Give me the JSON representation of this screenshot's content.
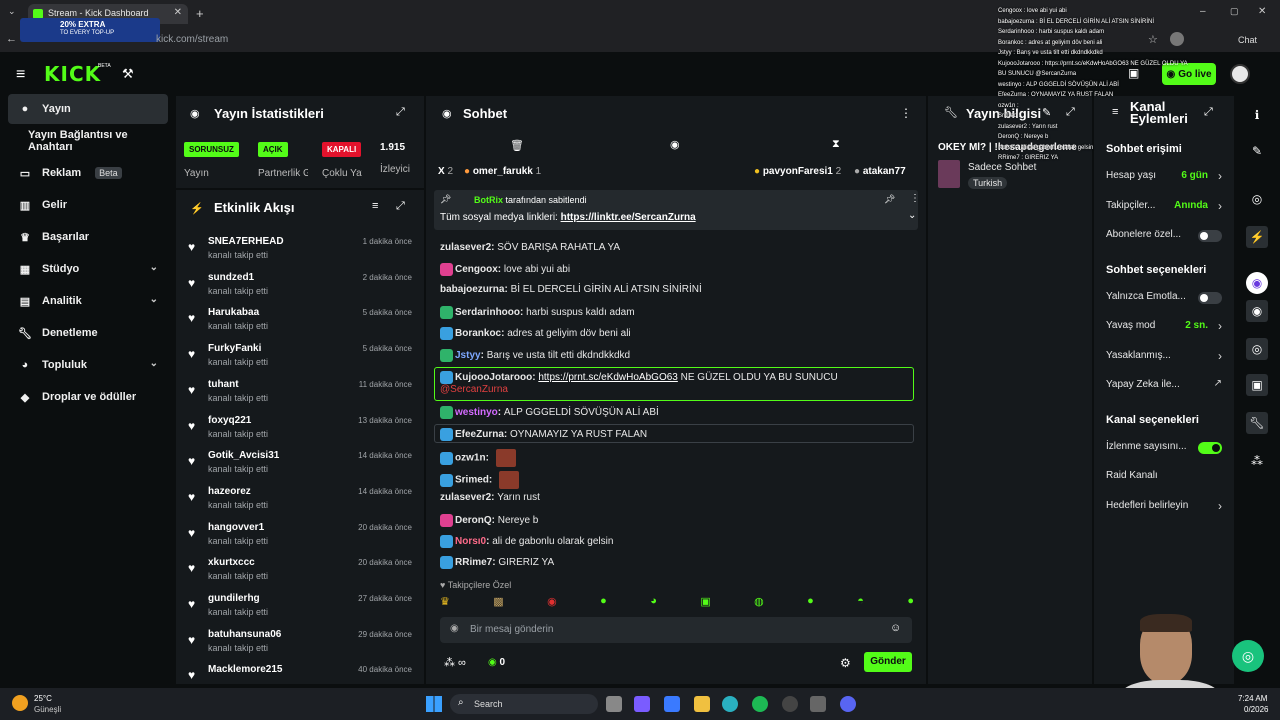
{
  "browser": {
    "tab_title": "Stream - Kick Dashboard",
    "url_visible": "kick.com/stream",
    "chat_button": "Chat",
    "promo_text": "20% EXTRA",
    "promo_sub": "TO EVERY TOP-UP"
  },
  "header": {
    "logo": "KICK",
    "logo_badge": "BETA",
    "go_live": "Go live"
  },
  "sidebar": {
    "items": [
      {
        "label": "Yayın",
        "icon": "broadcast-icon"
      },
      {
        "label": "Yayın Bağlantısı ve Anahtarı",
        "icon": ""
      },
      {
        "label": "Reklam",
        "icon": "tv-icon",
        "badge": "Beta"
      },
      {
        "label": "Gelir",
        "icon": "chart-icon"
      },
      {
        "label": "Başarılar",
        "icon": "trophy-icon"
      },
      {
        "label": "Stüdyo",
        "icon": "studio-icon"
      },
      {
        "label": "Analitik",
        "icon": "analytics-icon"
      },
      {
        "label": "Denetleme",
        "icon": "wrench-icon"
      },
      {
        "label": "Topluluk",
        "icon": "community-icon"
      },
      {
        "label": "Droplar ve ödüller",
        "icon": "gift-icon"
      }
    ]
  },
  "stats": {
    "title": "Yayın İstatistikleri",
    "cols": [
      {
        "badge": "SORUNSUZ",
        "label": "Yayın",
        "color": "#53fc18"
      },
      {
        "badge": "AÇIK",
        "label": "Partnerlik Gelir",
        "color": "#53fc18"
      },
      {
        "badge": "KAPALI",
        "label": "Çoklu Yayın",
        "color": "#e3122c"
      },
      {
        "badge": "1.915",
        "label": "İzleyici",
        "color": ""
      }
    ]
  },
  "events": {
    "title": "Etkinlik Akışı",
    "items": [
      {
        "name": "SNEA7ERHEAD",
        "sub": "kanalı takip etti",
        "time": "1 dakika önce"
      },
      {
        "name": "sundzed1",
        "sub": "kanalı takip etti",
        "time": "2 dakika önce"
      },
      {
        "name": "Harukabaa",
        "sub": "kanalı takip etti",
        "time": "5 dakika önce"
      },
      {
        "name": "FurkyFanki",
        "sub": "kanalı takip etti",
        "time": "5 dakika önce"
      },
      {
        "name": "tuhant",
        "sub": "kanalı takip etti",
        "time": "11 dakika önce"
      },
      {
        "name": "foxyq221",
        "sub": "kanalı takip etti",
        "time": "13 dakika önce"
      },
      {
        "name": "Gotik_Avcisi31",
        "sub": "kanalı takip etti",
        "time": "14 dakika önce"
      },
      {
        "name": "hazeorez",
        "sub": "kanalı takip etti",
        "time": "14 dakika önce"
      },
      {
        "name": "hangovver1",
        "sub": "kanalı takip etti",
        "time": "20 dakika önce"
      },
      {
        "name": "xkurtxccc",
        "sub": "kanalı takip etti",
        "time": "20 dakika önce"
      },
      {
        "name": "gundilerhg",
        "sub": "kanalı takip etti",
        "time": "27 dakika önce"
      },
      {
        "name": "batuhansuna06",
        "sub": "kanalı takip etti",
        "time": "29 dakika önce"
      },
      {
        "name": "Macklemore215",
        "sub": "",
        "time": "40 dakika önce"
      }
    ]
  },
  "chat": {
    "title": "Sohbet",
    "top_users": [
      {
        "name": "omer_farukk",
        "count": "1"
      },
      {
        "name": "pavyonFaresi1",
        "count": "2"
      },
      {
        "name": "atakan77",
        "count": ""
      }
    ],
    "x_count": "2",
    "pinned_by": "BotRix",
    "pinned_suffix": "tarafından sabitlendi",
    "pinned_text": "Tüm sosyal medya linkleri:",
    "pinned_link": "https://linktr.ee/SercanZurna",
    "messages": [
      {
        "user": "zulasever2",
        "text": "SÖV BARIŞA RAHATLA YA",
        "color": "#e8e8e8"
      },
      {
        "user": "Cengoox",
        "text": "love abi yui abi",
        "color": "#e8e8e8"
      },
      {
        "user": "babajoezurna",
        "text": "Bİ EL DERCELİ GİRİN ALİ ATSIN SİNİRİNİ",
        "color": "#e8e8e8"
      },
      {
        "user": "Serdarinhooo",
        "text": "harbi suspus kaldı adam",
        "color": "#e8e8e8"
      },
      {
        "user": "Borankoc",
        "text": "adres at geliyim döv beni ali",
        "color": "#e8e8e8"
      },
      {
        "user": "Jstyy",
        "text": "Barış ve usta tilt etti dkdndkkdkd",
        "color": "#7ea8ff"
      },
      {
        "user": "KujoooJotarooo",
        "text": "NE GÜZEL OLDU YA BU SUNUCU",
        "link": "https://prnt.sc/eKdwHoAbGO63",
        "mention": "@SercanZurna",
        "color": "#e8e8e8"
      },
      {
        "user": "westinyo",
        "text": "ALP GGGELDİ SÖVÜŞÜN ALİ ABİ",
        "color": "#d36bff"
      },
      {
        "user": "EfeeZurna",
        "text": "OYNAMAYIZ YA RUST FALAN",
        "color": "#e8e8e8"
      },
      {
        "user": "ozw1n",
        "text": "",
        "color": "#e8e8e8"
      },
      {
        "user": "Srimed",
        "text": "",
        "color": "#e8e8e8"
      },
      {
        "user": "zulasever2",
        "text": "Yarın rust",
        "color": "#e8e8e8"
      },
      {
        "user": "DeronQ",
        "text": "Nereye b",
        "color": "#e8e8e8"
      },
      {
        "user": "Norsı0",
        "text": "ali de gabonlu olarak gelsin",
        "color": "#ff6b8a"
      },
      {
        "user": "RRime7",
        "text": "GIRERIZ YA",
        "color": "#e8e8e8"
      }
    ],
    "followers_only": "Takipçilere Özel",
    "input_placeholder": "Bir mesaj gönderin",
    "send_label": "Gönder",
    "points": "0"
  },
  "stream_info": {
    "title": "Yayın bilgisi",
    "stream_title": "OKEY Mİ? | !hesapdegerleme",
    "category": "Sadece Sohbet",
    "language": "Turkish"
  },
  "channel_actions": {
    "title": "Kanal Eylemleri",
    "sections": [
      {
        "heading": "Sohbet erişimi",
        "items": [
          {
            "label": "Hesap yaşı",
            "value": "6 gün",
            "type": "arrow"
          },
          {
            "label": "Takipçiler...",
            "value": "Anında",
            "type": "arrow"
          },
          {
            "label": "Abonelere özel...",
            "value": "",
            "type": "toggle-off"
          }
        ]
      },
      {
        "heading": "Sohbet seçenekleri",
        "items": [
          {
            "label": "Yalnızca Emotla...",
            "value": "",
            "type": "toggle-off"
          },
          {
            "label": "Yavaş mod",
            "value": "2 sn.",
            "type": "arrow"
          },
          {
            "label": "Yasaklanmış...",
            "value": "",
            "type": "arrow"
          },
          {
            "label": "Yapay Zeka ile...",
            "value": "",
            "type": "external"
          }
        ]
      },
      {
        "heading": "Kanal seçenekleri",
        "items": [
          {
            "label": "İzlenme sayısını...",
            "value": "",
            "type": "toggle-on"
          },
          {
            "label": "Raid Kanalı",
            "value": "",
            "type": "none"
          },
          {
            "label": "Hedefleri belirleyin",
            "value": "",
            "type": "arrow"
          }
        ]
      }
    ]
  },
  "overlay_chat": [
    "Cengoox : love abi yui abi",
    "babajoezurna : Bİ EL DERCELİ GİRİN ALİ ATSIN SİNİRİNİ",
    "Serdarinhooo : harbi suspus kaldı adam",
    "Borankoc : adres at geliyim döv beni ali",
    "Jstyy : Barış ve usta tilt etti dkdndkkdkd",
    "KujoooJotarooo : https://prnt.sc/eKdwHoAbGO63 NE GÜZEL OLDU YA",
    "BU SUNUCU @SercanZurna",
    "westinyo : ALP GGGELDİ SÖVÜŞÜN ALİ ABİ",
    "EfeeZurna : OYNAMAYIZ YA RUST FALAN",
    "ozw1n :",
    "Srimed :",
    "zulasever2 : Yarın rust",
    "DeronQ : Nereye b",
    "Norsı0 : ali de gabonlu olarak gelsin",
    "RRime7 : GIRERIZ YA"
  ],
  "taskbar": {
    "weather_temp": "25°C",
    "weather_desc": "Güneşli",
    "search_label": "Search",
    "time": "7:24 AM",
    "date": "0/2026"
  },
  "colors": {
    "accent": "#53fc18",
    "panel": "#15191c",
    "bg": "#0b0e0f",
    "danger": "#e3122c"
  }
}
